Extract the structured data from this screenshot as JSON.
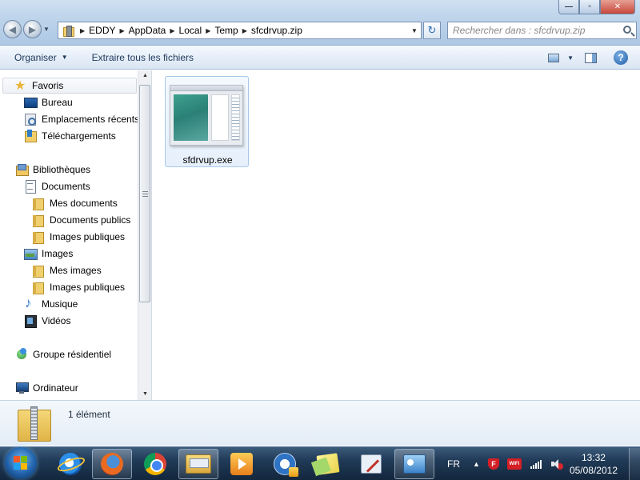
{
  "window": {
    "breadcrumbs": [
      "EDDY",
      "AppData",
      "Local",
      "Temp",
      "sfcdrvup.zip"
    ],
    "search_placeholder": "Rechercher dans : sfcdrvup.zip",
    "min_glyph": "—",
    "max_glyph": "▫",
    "close_glyph": "✕"
  },
  "toolbar": {
    "organize_label": "Organiser",
    "extract_label": "Extraire tous les fichiers",
    "help_glyph": "?"
  },
  "sidebar": {
    "items": [
      {
        "label": "Favoris",
        "icon": "star-icon"
      },
      {
        "label": "Bureau",
        "icon": "desktop-icon"
      },
      {
        "label": "Emplacements récents",
        "icon": "recent-places-icon"
      },
      {
        "label": "Téléchargements",
        "icon": "downloads-icon"
      },
      {
        "label": "Bibliothèques",
        "icon": "libraries-icon"
      },
      {
        "label": "Documents",
        "icon": "documents-icon"
      },
      {
        "label": "Mes documents",
        "icon": "folder-icon"
      },
      {
        "label": "Documents publics",
        "icon": "folder-icon"
      },
      {
        "label": "Images publiques",
        "icon": "folder-icon"
      },
      {
        "label": "Images",
        "icon": "pictures-icon"
      },
      {
        "label": "Mes images",
        "icon": "folder-icon"
      },
      {
        "label": "Images publiques",
        "icon": "folder-icon"
      },
      {
        "label": "Musique",
        "icon": "music-icon"
      },
      {
        "label": "Vidéos",
        "icon": "videos-icon"
      },
      {
        "label": "Groupe résidentiel",
        "icon": "homegroup-icon"
      },
      {
        "label": "Ordinateur",
        "icon": "computer-icon"
      }
    ]
  },
  "content": {
    "files": [
      {
        "name": "sfdrvup.exe",
        "icon": "application-icon"
      }
    ]
  },
  "details": {
    "item_count": "1 élément"
  },
  "taskbar": {
    "apps": [
      "internet-explorer",
      "firefox",
      "chrome",
      "windows-explorer",
      "media-player",
      "ccleaner",
      "sticky-notes",
      "snipping-tool",
      "control-panel"
    ],
    "language": "FR",
    "time": "13:32",
    "date": "05/08/2012"
  },
  "colors": {
    "accent": "#1e395b",
    "selection_border": "#a8c8ea",
    "taskbar": "#203a57"
  }
}
